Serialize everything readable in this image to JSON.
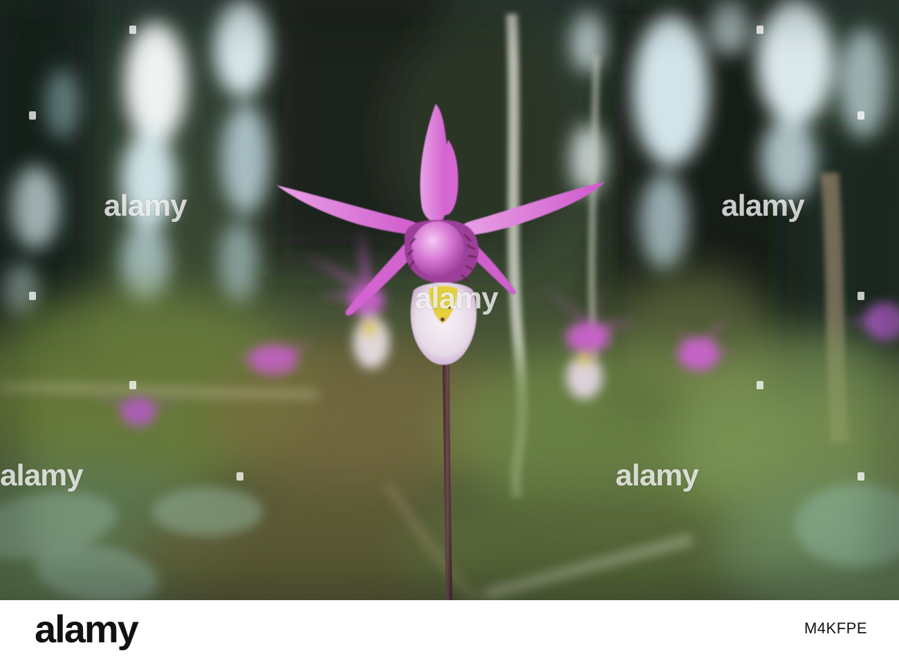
{
  "photo": {
    "subject": "pink orchid flower",
    "colors": {
      "petal": "#d45fd0",
      "petal_light": "#f0a8ec",
      "lip": "#efe6ef",
      "lip_yellow": "#e8d23a",
      "stem": "#5a3b3f",
      "forest_dark": "#1f2a22",
      "foliage": "#5d7a3e",
      "bokeh": "#d8e8ee"
    }
  },
  "watermarks": [
    "alamy",
    "alamy",
    "alamy",
    "alamy",
    "alamy",
    "alamy",
    "alamy",
    "alamy",
    "alamy"
  ],
  "footer": {
    "brand": "alamy",
    "image_id": "M4KFPE"
  }
}
